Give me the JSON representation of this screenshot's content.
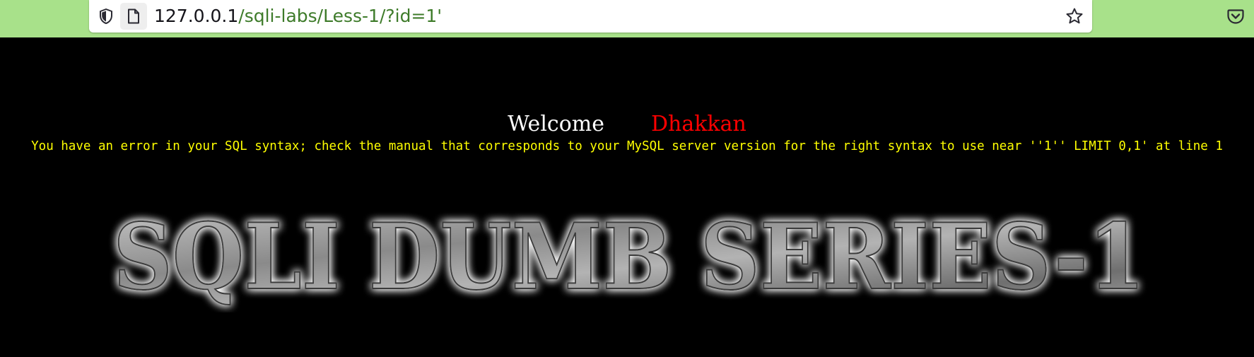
{
  "browser": {
    "url_host": "127.0.0.1",
    "url_path": "/sqli-labs/Less-1/?id=1'"
  },
  "icons": {
    "tracking_protection": "shield-icon",
    "page_info": "page-icon",
    "bookmark": "star-icon",
    "pocket": "pocket-icon"
  },
  "page": {
    "welcome": "Welcome",
    "user_name": "Dhakkan",
    "error_message": "You have an error in your SQL syntax; check the manual that corresponds to your MySQL server version for the right syntax to use near ''1'' LIMIT 0,1' at line 1",
    "banner_title": "SQLI DUMB SERIES-1"
  },
  "colors": {
    "toolbar_bg": "#a8e18a",
    "page_bg": "#000000",
    "welcome": "#ffffff",
    "user_name": "#ff0000",
    "error_text": "#ffff00",
    "url_path": "#3e7b2a"
  }
}
